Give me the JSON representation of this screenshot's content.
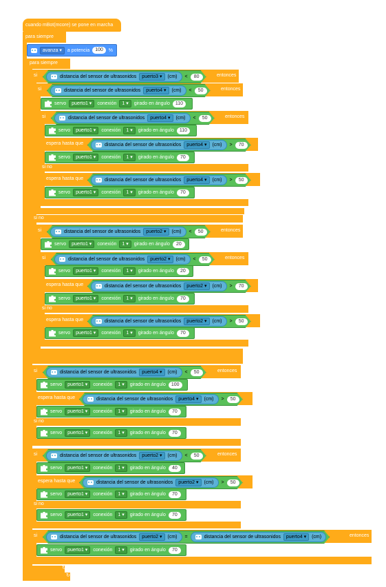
{
  "labels": {
    "hat": "cuando mBot(mcore) se pone en marcha",
    "forever": "para siempre",
    "move": "avanza ▾",
    "speed": "a potencia",
    "percent": "%",
    "if": "si",
    "else": "si no",
    "then": "entonces",
    "sensor": "distancia del sensor de ultrasonidos",
    "cm": "(cm)",
    "servo": "servo",
    "port1": "puerto1 ▾",
    "conn": "conexión",
    "one": "1 ▾",
    "angle": "girado en ángulo",
    "wait": "espera hasta que",
    "lt": "<",
    "gt": ">",
    "eq": "=",
    "arrow": "↻"
  },
  "speed_value": "100",
  "ports": {
    "p2": "puerto2 ▾",
    "p3": "puerto3 ▾",
    "p4": "puerto4 ▾"
  },
  "values": {
    "v80": "80",
    "v50": "50",
    "v110": "110",
    "v70": "70",
    "v20": "20",
    "v100": "100",
    "v40": "40"
  }
}
